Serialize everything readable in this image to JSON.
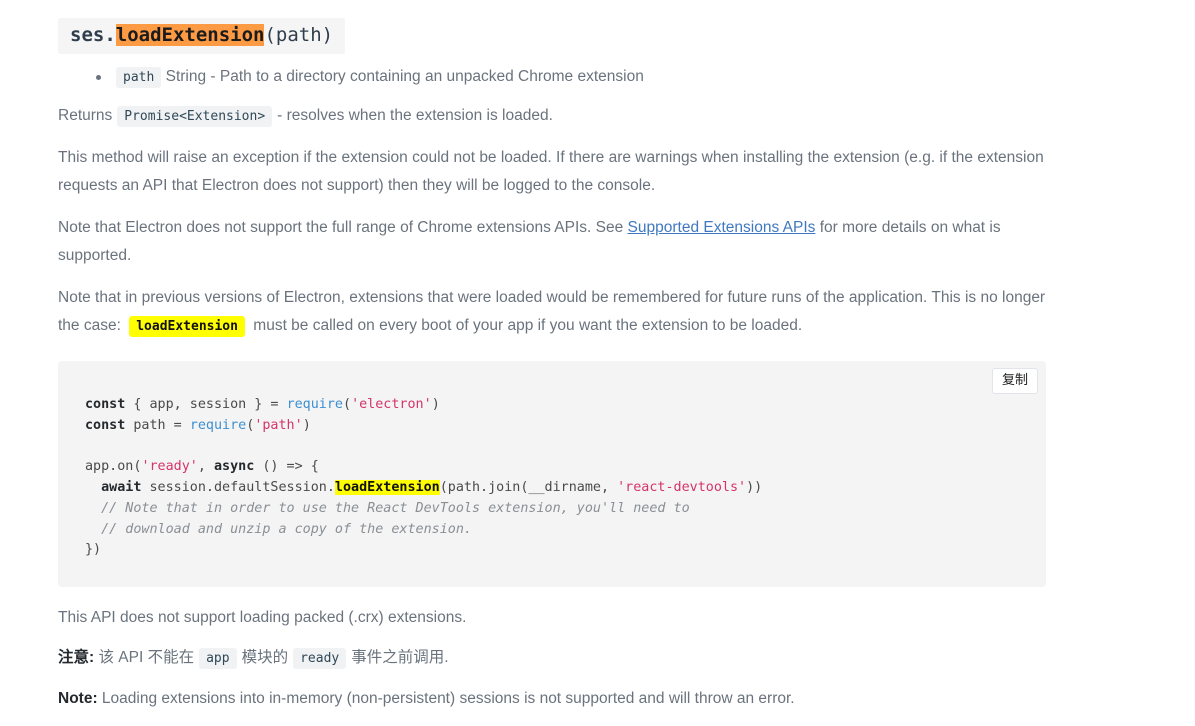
{
  "heading": {
    "prefix": "ses.",
    "highlight": "loadExtension",
    "args": "(path)"
  },
  "params": [
    {
      "code": "path",
      "description": "String - Path to a directory containing an unpacked Chrome extension"
    }
  ],
  "returns": {
    "label": "Returns",
    "type": "Promise<Extension>",
    "description": "- resolves when the extension is loaded."
  },
  "paragraphs": {
    "exception_note": "This method will raise an exception if the extension could not be loaded. If there are warnings when installing the extension (e.g. if the extension requests an API that Electron does not support) then they will be logged to the console.",
    "apis_note_before": "Note that Electron does not support the full range of Chrome extensions APIs. See",
    "apis_link": "Supported Extensions APIs",
    "apis_note_after": "for more details on what is supported.",
    "persistence_before": "Note that in previous versions of Electron, extensions that were loaded would be remembered for future runs of the application. This is no longer the case:",
    "persistence_code": "loadExtension",
    "persistence_after": "must be called on every boot of your app if you want the extension to be loaded."
  },
  "codeblock": {
    "copy_label": "复制",
    "lines": [
      {
        "tokens": [
          {
            "t": "const",
            "c": "kw"
          },
          {
            "t": " { app, session } = ",
            "c": "pl"
          },
          {
            "t": "require",
            "c": "fn"
          },
          {
            "t": "(",
            "c": "pl"
          },
          {
            "t": "'electron'",
            "c": "str"
          },
          {
            "t": ")",
            "c": "pl"
          }
        ]
      },
      {
        "tokens": [
          {
            "t": "const",
            "c": "kw"
          },
          {
            "t": " path = ",
            "c": "pl"
          },
          {
            "t": "require",
            "c": "fn"
          },
          {
            "t": "(",
            "c": "pl"
          },
          {
            "t": "'path'",
            "c": "str"
          },
          {
            "t": ")",
            "c": "pl"
          }
        ]
      },
      {
        "tokens": []
      },
      {
        "tokens": [
          {
            "t": "app.on(",
            "c": "pl"
          },
          {
            "t": "'ready'",
            "c": "str"
          },
          {
            "t": ", ",
            "c": "pl"
          },
          {
            "t": "async",
            "c": "kw"
          },
          {
            "t": " () => {",
            "c": "pl"
          }
        ]
      },
      {
        "tokens": [
          {
            "t": "  ",
            "c": "pl"
          },
          {
            "t": "await",
            "c": "kw"
          },
          {
            "t": " session.defaultSession.",
            "c": "pl"
          },
          {
            "t": "loadExtension",
            "c": "hl-yellow"
          },
          {
            "t": "(path.join(__dirname, ",
            "c": "pl"
          },
          {
            "t": "'react-devtools'",
            "c": "str"
          },
          {
            "t": "))",
            "c": "pl"
          }
        ]
      },
      {
        "tokens": [
          {
            "t": "  // Note that in order to use the React DevTools extension, you'll need to",
            "c": "cm"
          }
        ]
      },
      {
        "tokens": [
          {
            "t": "  // download and unzip a copy of the extension.",
            "c": "cm"
          }
        ]
      },
      {
        "tokens": [
          {
            "t": "})",
            "c": "pl"
          }
        ]
      }
    ]
  },
  "footer": {
    "crx_note": "This API does not support loading packed (.crx) extensions.",
    "cn_note_label": "注意:",
    "cn_note_part1": "该 API 不能在",
    "cn_code_app": "app",
    "cn_note_part2": "模块的",
    "cn_code_ready": "ready",
    "cn_note_part3": "事件之前调用.",
    "en_note_label": "Note:",
    "en_note_text": "Loading extensions into in-memory (non-persistent) sessions is not supported and will throw an error."
  },
  "colors": {
    "highlight_orange": "#fd9a44",
    "highlight_yellow": "#ffff00",
    "link_blue": "#4078c0",
    "code_bg": "#f4f4f4",
    "text_grey": "#6a737d"
  }
}
